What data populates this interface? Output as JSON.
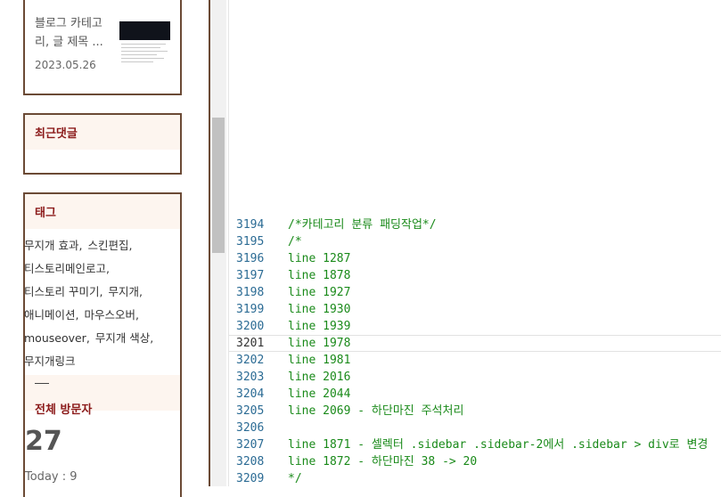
{
  "sidebar": {
    "recent_post": {
      "title": "블로그 카테고리, 글 제목 ...",
      "date": "2023.05.26"
    },
    "comments": {
      "heading": "최근댓글"
    },
    "tags": {
      "heading": "태그",
      "items": [
        "무지개 효과,",
        "스킨편집,",
        "티스토리메인로고,",
        "티스토리 꾸미기,",
        "무지개,",
        "애니메이션,",
        "마우스오버,",
        "mouseover,",
        "무지개 색상,",
        "무지개링크"
      ]
    },
    "visitors": {
      "dash": "—",
      "heading": "전체 방문자",
      "total": "27",
      "today": "Today : 9"
    }
  },
  "editor": {
    "current_line": "3201",
    "lines": [
      {
        "n": "3194",
        "t": "/*카테고리 분류 패딩작업*/"
      },
      {
        "n": "3195",
        "t": "/*"
      },
      {
        "n": "3196",
        "t": "line 1287"
      },
      {
        "n": "3197",
        "t": "line 1878"
      },
      {
        "n": "3198",
        "t": "line 1927"
      },
      {
        "n": "3199",
        "t": "line 1930"
      },
      {
        "n": "3200",
        "t": "line 1939"
      },
      {
        "n": "3201",
        "t": "line 1978"
      },
      {
        "n": "3202",
        "t": "line 1981"
      },
      {
        "n": "3203",
        "t": "line 2016"
      },
      {
        "n": "3204",
        "t": "line 2044"
      },
      {
        "n": "3205",
        "t": "line 2069 - 하단마진 주석처리"
      },
      {
        "n": "3206",
        "t": ""
      },
      {
        "n": "3207",
        "t": "line 1871 - 셀렉터 .sidebar .sidebar-2에서 .sidebar > div로 변경"
      },
      {
        "n": "3208",
        "t": "line 1872 - 하단마진 38 -> 20"
      },
      {
        "n": "3209",
        "t": "*/"
      }
    ]
  }
}
